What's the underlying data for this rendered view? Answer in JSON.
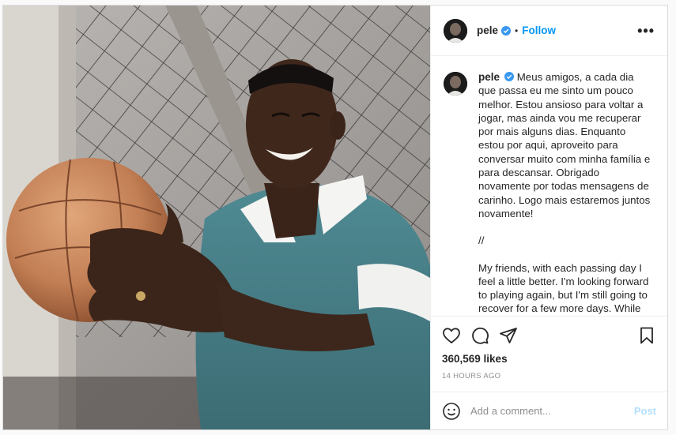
{
  "post": {
    "username": "pele",
    "follow_label": "Follow",
    "separator": "•",
    "more_label": "•••",
    "photo_icon": "photo-pele-with-football"
  },
  "caption": {
    "username": "pele",
    "portuguese": "Meus amigos, a cada dia que passa eu me sinto um pouco melhor. Estou ansioso para voltar a jogar, mas ainda vou me recuperar por mais alguns dias. Enquanto estou por aqui, aproveito para conversar muito com minha família e para descansar. Obrigado novamente por todas mensagens de carinho. Logo mais estaremos juntos novamente!",
    "divider": "//",
    "english": "My friends, with each passing day I feel a little better. I'm looking forward to playing again, but I'm still going to recover for a few more days. While I'm here, I take the opportunity to talk a lot with my family and to rest. Thanks again for all the loving messages."
  },
  "actions": {
    "icons": [
      "heart-icon",
      "comment-icon",
      "share-icon",
      "bookmark-icon"
    ],
    "likes": "360,569 likes",
    "timestamp": "14 HOURS AGO"
  },
  "comment": {
    "placeholder": "Add a comment...",
    "post_label": "Post",
    "emoji_icon": "smiley-icon"
  },
  "colors": {
    "accent": "#0095f6",
    "post_disabled": "#b2dffc",
    "border": "#dbdbdb",
    "muted_text": "#8e8e8e"
  }
}
